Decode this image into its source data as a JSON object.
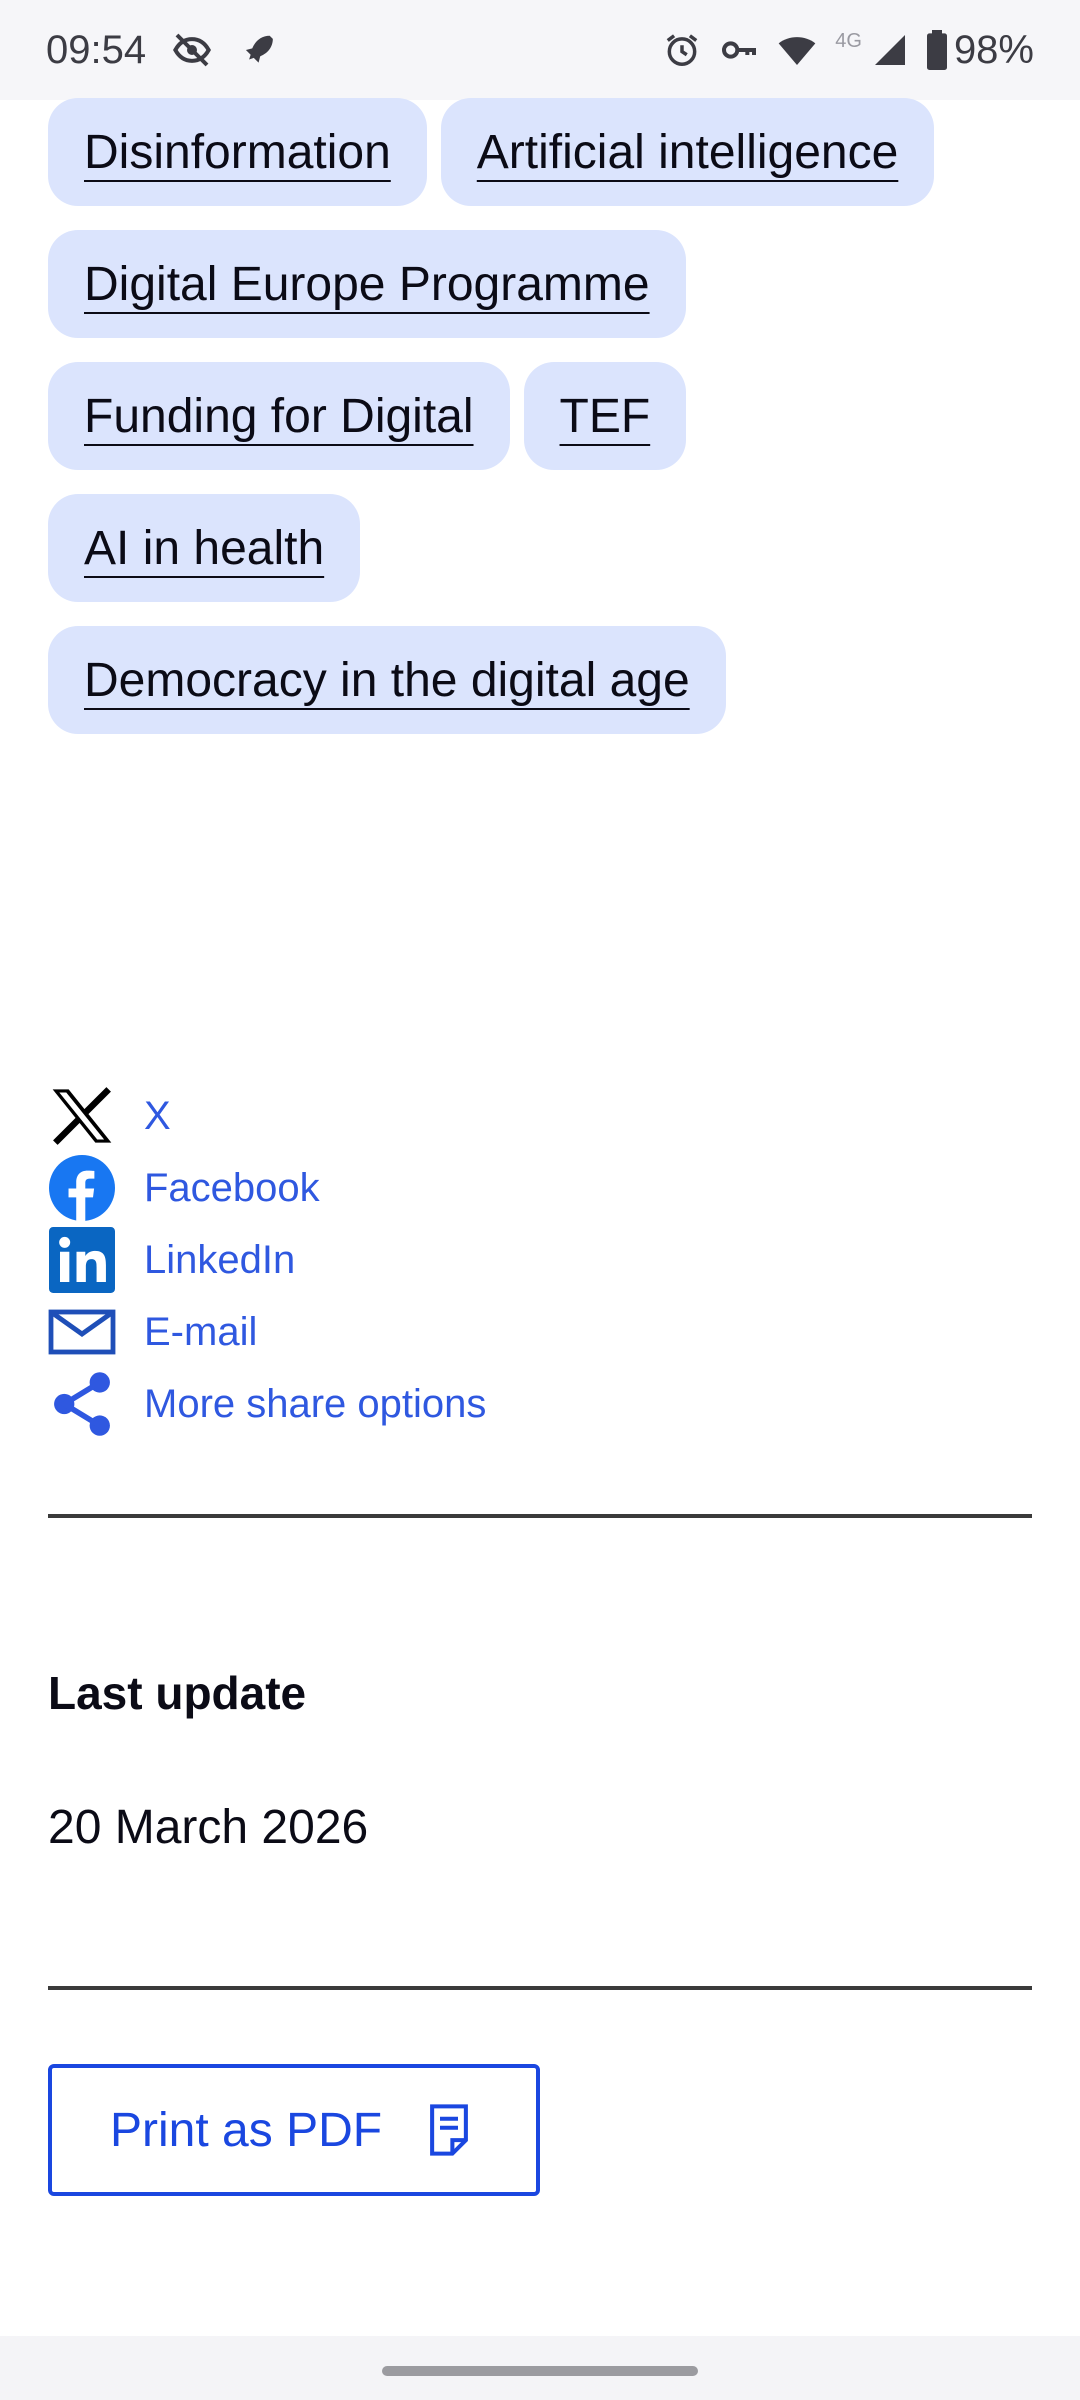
{
  "status_bar": {
    "time": "09:54",
    "network": "4G",
    "battery": "98%"
  },
  "tags": [
    [
      "Disinformation",
      "Artificial intelligence"
    ],
    [
      "Digital Europe Programme"
    ],
    [
      "Funding for Digital",
      "TEF"
    ],
    [
      "AI in health"
    ],
    [
      "Democracy in the digital age"
    ]
  ],
  "share": {
    "x": "X",
    "facebook": "Facebook",
    "linkedin": "LinkedIn",
    "email": "E-mail",
    "more": "More share options"
  },
  "last_update": {
    "heading": "Last update",
    "date": "20 March 2026"
  },
  "print_button": "Print as PDF",
  "colors": {
    "tag_bg": "#dbe4fd",
    "link": "#2f58e0",
    "button": "#1a47e0",
    "facebook": "#1877f2",
    "linkedin": "#0a66c2"
  }
}
